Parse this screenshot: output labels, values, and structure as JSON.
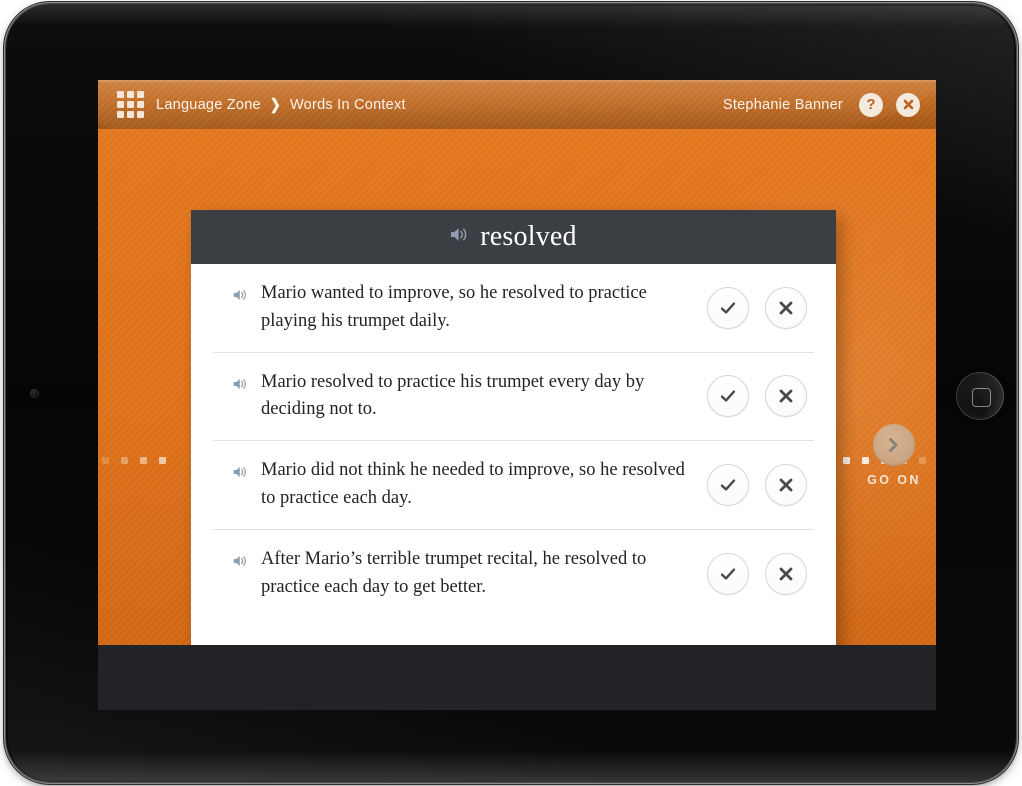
{
  "header": {
    "menu_icon": "grid-menu-icon",
    "breadcrumb": {
      "root": "Language Zone",
      "separator": "❯",
      "current": "Words In Context"
    },
    "user_name": "Stephanie Banner",
    "help_label": "?",
    "help_icon": "question-mark-icon",
    "close_icon": "close-x-icon"
  },
  "card": {
    "speaker_icon": "speaker-icon",
    "word": "resolved",
    "answers": [
      {
        "speaker_icon": "speaker-icon",
        "text": "Mario wanted to improve, so he resolved to practice playing his trumpet daily.",
        "accept_icon": "check-icon",
        "reject_icon": "x-icon"
      },
      {
        "speaker_icon": "speaker-icon",
        "text": "Mario resolved to practice his trumpet every day by deciding not to.",
        "accept_icon": "check-icon",
        "reject_icon": "x-icon"
      },
      {
        "speaker_icon": "speaker-icon",
        "text": "Mario did not think he needed to improve, so he resolved to practice each day.",
        "accept_icon": "check-icon",
        "reject_icon": "x-icon"
      },
      {
        "speaker_icon": "speaker-icon",
        "text": "After Mario’s terrible trumpet recital, he resolved to practice each day to get better.",
        "accept_icon": "check-icon",
        "reject_icon": "x-icon"
      }
    ]
  },
  "go_on": {
    "label": "GO ON",
    "icon": "chevron-right-icon"
  },
  "colors": {
    "brand_orange": "#dd7119",
    "header_orange": "#b95f16",
    "card_titlebar": "#3b3e42",
    "speaker_blue": "#8d9dae",
    "go_on_circle": "#cba785",
    "glyph_dark": "#4a4a4a",
    "bottom_bar": "#222326"
  }
}
